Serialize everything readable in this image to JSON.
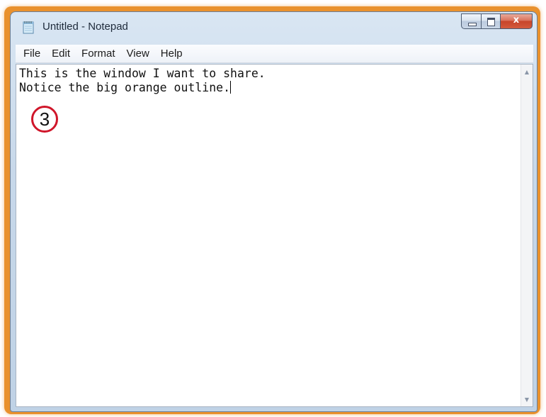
{
  "window": {
    "title": "Untitled - Notepad",
    "app_icon": "notepad-icon",
    "outline_color": "#e9912d",
    "caption_buttons": {
      "minimize": "minimize-icon",
      "maximize": "maximize-icon",
      "close_glyph": "x",
      "close_color": "#c7452a"
    }
  },
  "menu": {
    "items": [
      "File",
      "Edit",
      "Format",
      "View",
      "Help"
    ]
  },
  "editor": {
    "lines": [
      "This is the window I want to share.",
      "Notice the big orange outline."
    ]
  },
  "annotation": {
    "step_number": "3",
    "ring_color": "#d0162a"
  },
  "scrollbar": {
    "up_icon": "scroll-up-arrow-icon",
    "down_icon": "scroll-down-arrow-icon"
  }
}
